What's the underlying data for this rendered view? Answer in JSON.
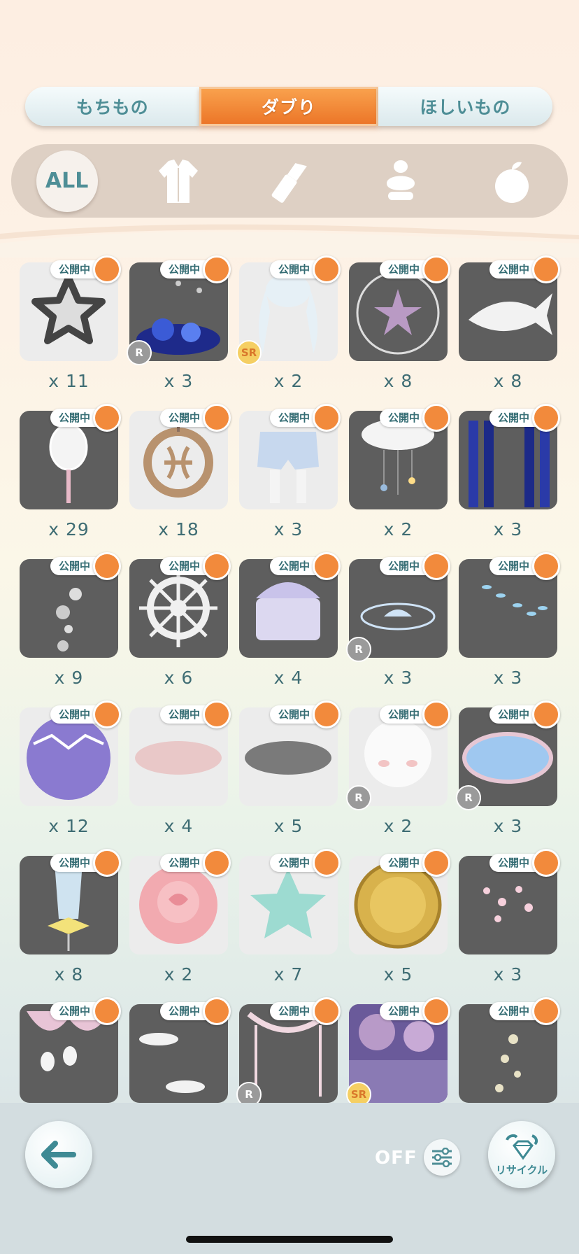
{
  "tabs": [
    {
      "label": "もちもの",
      "active": false
    },
    {
      "label": "ダブり",
      "active": true
    },
    {
      "label": "ほしいもの",
      "active": false
    }
  ],
  "categories": {
    "all_label": "ALL",
    "icons": [
      "outfit-icon",
      "lipstick-icon",
      "perfume-icon",
      "fruit-icon"
    ]
  },
  "badge_label": "公開中",
  "colors": {
    "accent_orange": "#f28a3c",
    "tab_text": "#4e8e96",
    "quantity_text": "#3f6d74"
  },
  "items": [
    {
      "name": "star-frame",
      "qty": "x 11",
      "rarity": "",
      "bg": "light"
    },
    {
      "name": "blue-coral-reef",
      "qty": "x 3",
      "rarity": "R",
      "bg": "dark"
    },
    {
      "name": "twin-tail-hair",
      "qty": "x 2",
      "rarity": "SR",
      "bg": "light"
    },
    {
      "name": "starfish-bubble",
      "qty": "x 8",
      "rarity": "",
      "bg": "dark"
    },
    {
      "name": "white-fish",
      "qty": "x 8",
      "rarity": "",
      "bg": "dark"
    },
    {
      "name": "lantern-wand",
      "qty": "x 29",
      "rarity": "",
      "bg": "dark"
    },
    {
      "name": "pisces-pendant",
      "qty": "x 18",
      "rarity": "",
      "bg": "light"
    },
    {
      "name": "polka-bloomers",
      "qty": "x 3",
      "rarity": "",
      "bg": "light"
    },
    {
      "name": "cloud-mobile",
      "qty": "x 2",
      "rarity": "",
      "bg": "dark"
    },
    {
      "name": "blue-curtains",
      "qty": "x 3",
      "rarity": "",
      "bg": "dark"
    },
    {
      "name": "bubbles",
      "qty": "x 9",
      "rarity": "",
      "bg": "dark"
    },
    {
      "name": "ship-wheel",
      "qty": "x 6",
      "rarity": "",
      "bg": "dark"
    },
    {
      "name": "jewel-chest",
      "qty": "x 4",
      "rarity": "",
      "bg": "dark"
    },
    {
      "name": "shell-light",
      "qty": "x 3",
      "rarity": "R",
      "bg": "dark"
    },
    {
      "name": "fish-school",
      "qty": "x 3",
      "rarity": "",
      "bg": "dark"
    },
    {
      "name": "purple-ball",
      "qty": "x 12",
      "rarity": "",
      "bg": "light"
    },
    {
      "name": "pink-fur",
      "qty": "x 4",
      "rarity": "",
      "bg": "light"
    },
    {
      "name": "gray-fur",
      "qty": "x 5",
      "rarity": "",
      "bg": "light"
    },
    {
      "name": "white-face",
      "qty": "x 2",
      "rarity": "R",
      "bg": "light"
    },
    {
      "name": "pond-mirror",
      "qty": "x 3",
      "rarity": "R",
      "bg": "dark"
    },
    {
      "name": "ribbon-glass",
      "qty": "x 8",
      "rarity": "",
      "bg": "dark"
    },
    {
      "name": "pink-rose",
      "qty": "x 2",
      "rarity": "",
      "bg": "light"
    },
    {
      "name": "mint-star",
      "qty": "x 7",
      "rarity": "",
      "bg": "light"
    },
    {
      "name": "gold-medal",
      "qty": "x 5",
      "rarity": "",
      "bg": "light"
    },
    {
      "name": "sakura-petals",
      "qty": "x 3",
      "rarity": "",
      "bg": "dark"
    },
    {
      "name": "drape-lanterns",
      "qty": "",
      "rarity": "",
      "bg": "dark"
    },
    {
      "name": "floating-plates",
      "qty": "",
      "rarity": "",
      "bg": "dark"
    },
    {
      "name": "ribbon-arch",
      "qty": "",
      "rarity": "R",
      "bg": "dark"
    },
    {
      "name": "purple-forest",
      "qty": "",
      "rarity": "SR",
      "bg": "dark"
    },
    {
      "name": "light-sparkles",
      "qty": "",
      "rarity": "",
      "bg": "dark"
    }
  ],
  "footer": {
    "filter_state": "OFF",
    "recycle_label": "リサイクル"
  }
}
